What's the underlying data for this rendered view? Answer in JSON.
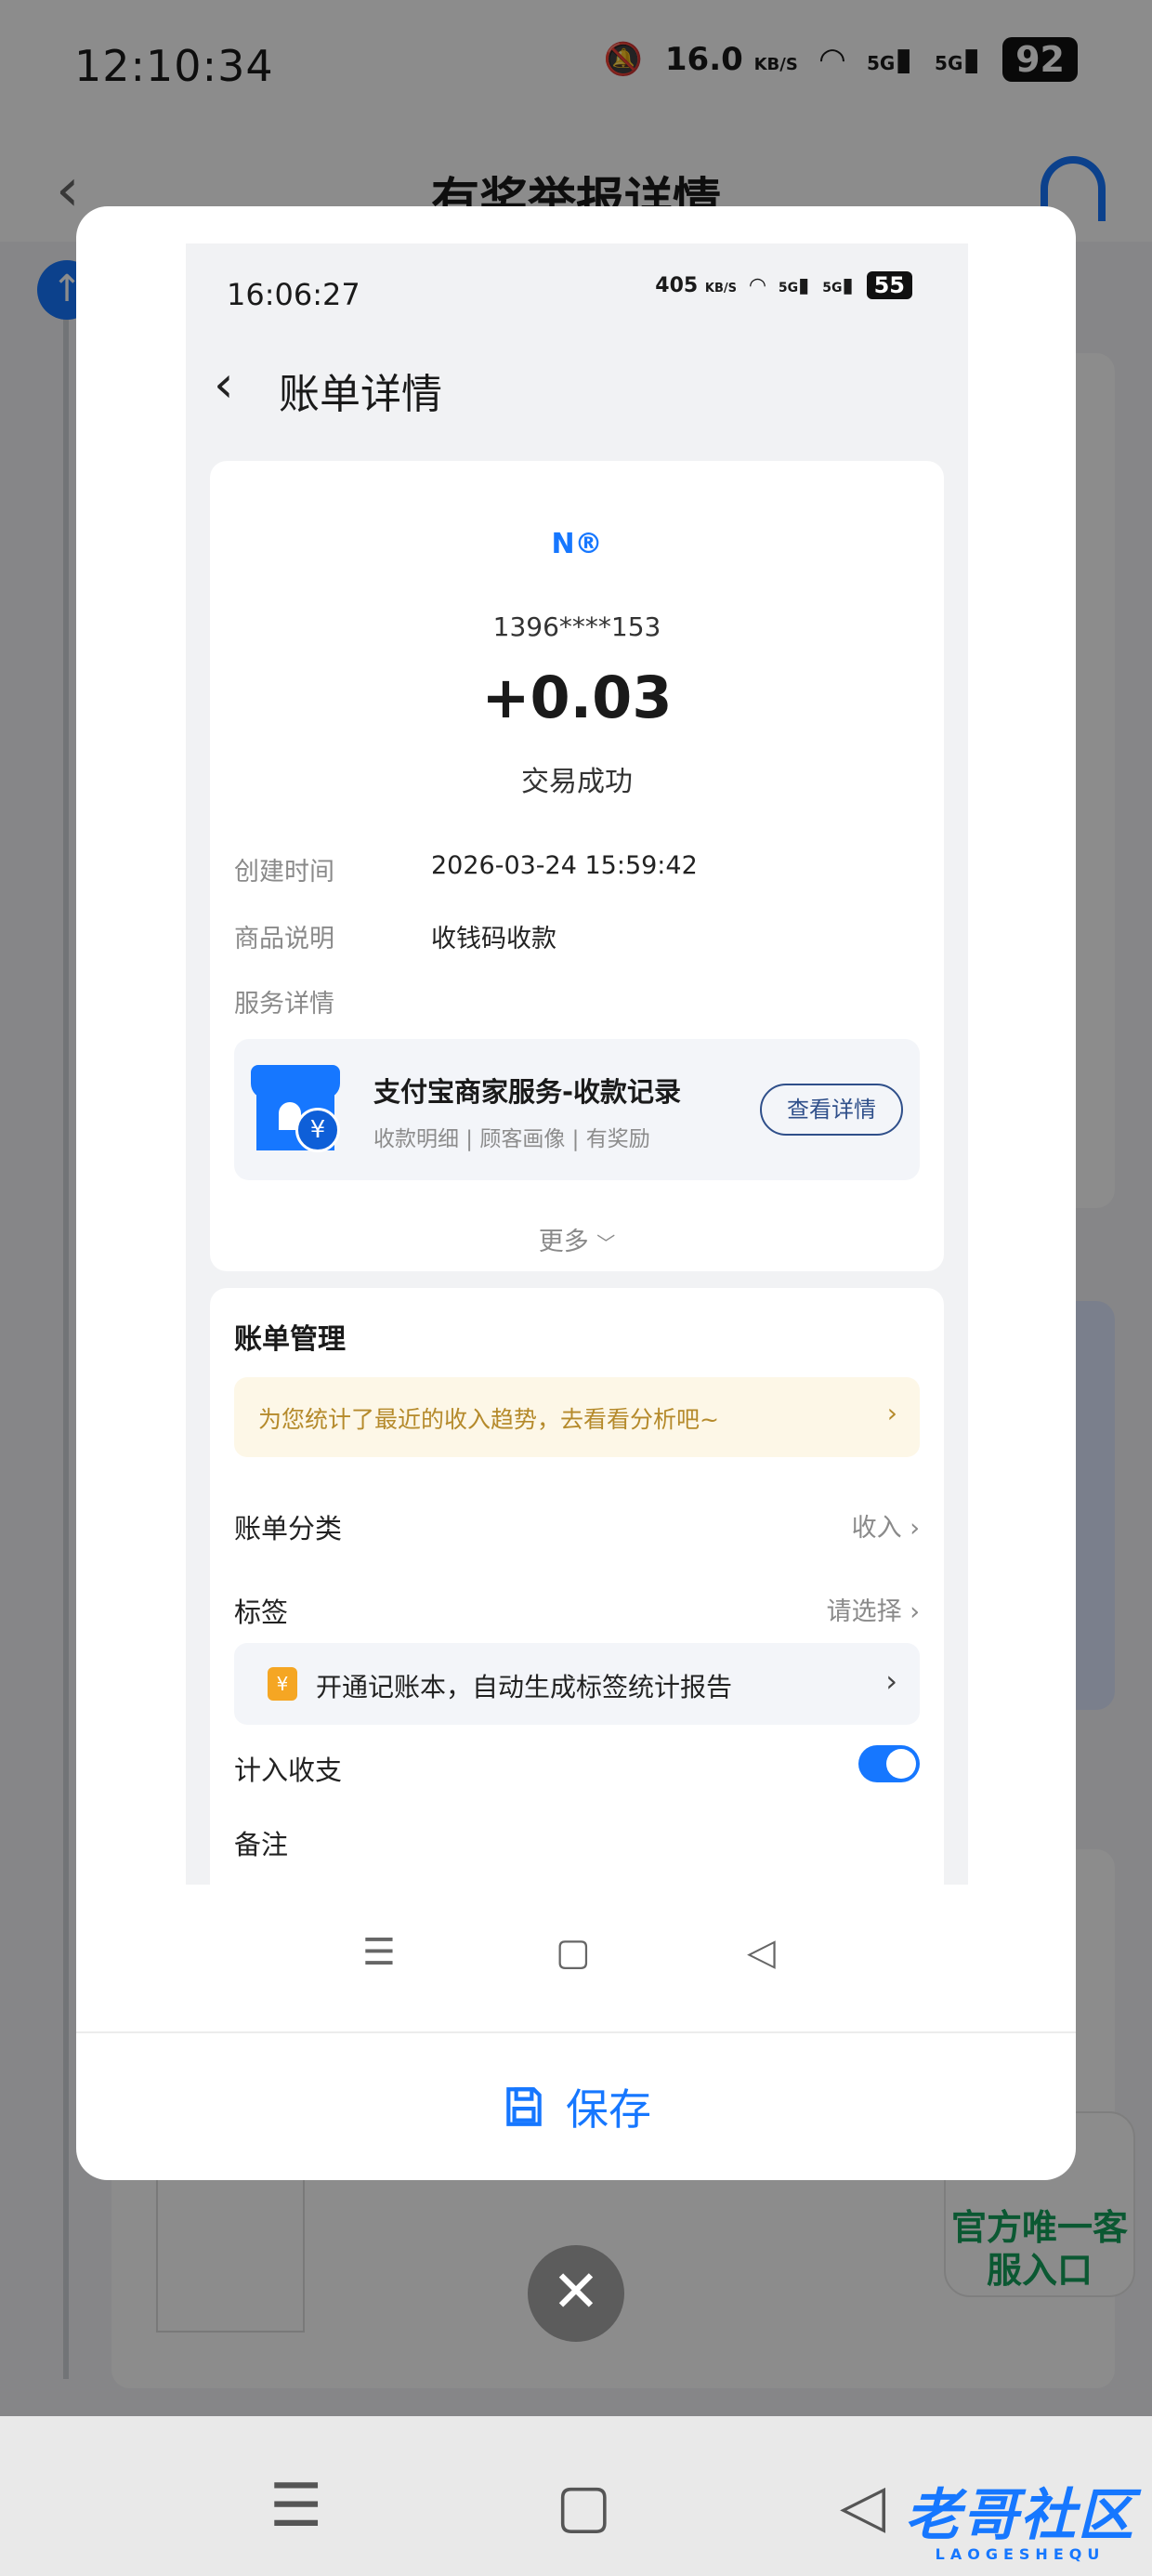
{
  "background": {
    "status_time": "12:10:34",
    "status_speed": "16.0",
    "status_speed_unit": "KB/S",
    "status_net1": "5G",
    "status_net2": "5G",
    "status_battery": "92",
    "header_title": "有奖举报详情",
    "service_entry": "官方唯一客服入口"
  },
  "modal": {
    "screenshot": {
      "status_time": "16:06:27",
      "status_speed": "405",
      "status_speed_unit": "KB/S",
      "status_net1": "5G",
      "status_net2": "5G",
      "status_battery": "55",
      "page_title": "账单详情",
      "logo_text": "N®",
      "counterparty": "1396****153",
      "amount": "+0.03",
      "status": "交易成功",
      "fields": [
        {
          "label": "创建时间",
          "value": "2026-03-24 15:59:42"
        },
        {
          "label": "商品说明",
          "value": "收钱码收款"
        }
      ],
      "service_label": "服务详情",
      "service": {
        "title": "支付宝商家服务-收款记录",
        "subtitle": "收款明细 | 顾客画像 | 有奖励",
        "button": "查看详情"
      },
      "more": "更多",
      "management": {
        "title": "账单管理",
        "tip": "为您统计了最近的收入趋势，去看看分析吧~",
        "category_label": "账单分类",
        "category_value": "收入",
        "tag_label": "标签",
        "tag_value": "请选择",
        "ledger_text": "开通记账本，自动生成标签统计报告",
        "count_label": "计入收支",
        "count_enabled": true,
        "note_label": "备注"
      }
    },
    "save_label": "保存"
  },
  "colors": {
    "accent": "#1677ff",
    "tip_bg": "#fdf7e7",
    "tip_text": "#b58a2b",
    "service_green": "#14a05c"
  },
  "watermark": {
    "text": "老哥社区",
    "subtext": "LAOGESHEQU"
  }
}
